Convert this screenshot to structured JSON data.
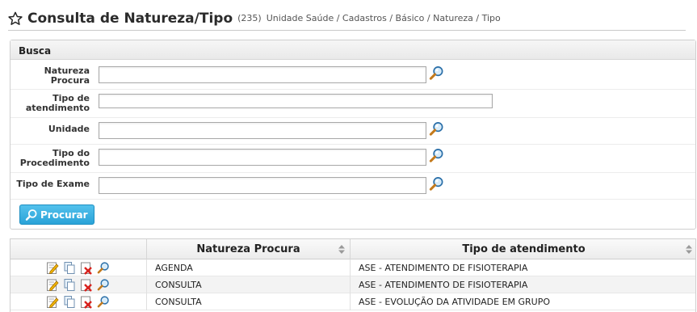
{
  "header": {
    "title": "Consulta de Natureza/Tipo",
    "count": "(235)",
    "breadcrumb": "Unidade Saúde / Cadastros / Básico / Natureza / Tipo"
  },
  "search": {
    "panel_title": "Busca",
    "fields": [
      {
        "label": "Natureza Procura",
        "value": ""
      },
      {
        "label": "Tipo de atendimento",
        "value": ""
      },
      {
        "label": "Unidade",
        "value": ""
      },
      {
        "label": "Tipo do Procedimento",
        "value": ""
      },
      {
        "label": "Tipo de Exame",
        "value": ""
      }
    ],
    "button_label": "Procurar"
  },
  "table": {
    "columns": [
      "Natureza Procura",
      "Tipo de atendimento"
    ],
    "rows": [
      {
        "natureza": "AGENDA",
        "tipo": "ASE - ATENDIMENTO DE FISIOTERAPIA"
      },
      {
        "natureza": "CONSULTA",
        "tipo": "ASE - ATENDIMENTO DE FISIOTERAPIA"
      },
      {
        "natureza": "CONSULTA",
        "tipo": "ASE - EVOLUÇÃO DA ATIVIDADE EM GRUPO"
      }
    ]
  },
  "colors": {
    "button": "#2aa3d8",
    "title": "#2b2b2b"
  }
}
